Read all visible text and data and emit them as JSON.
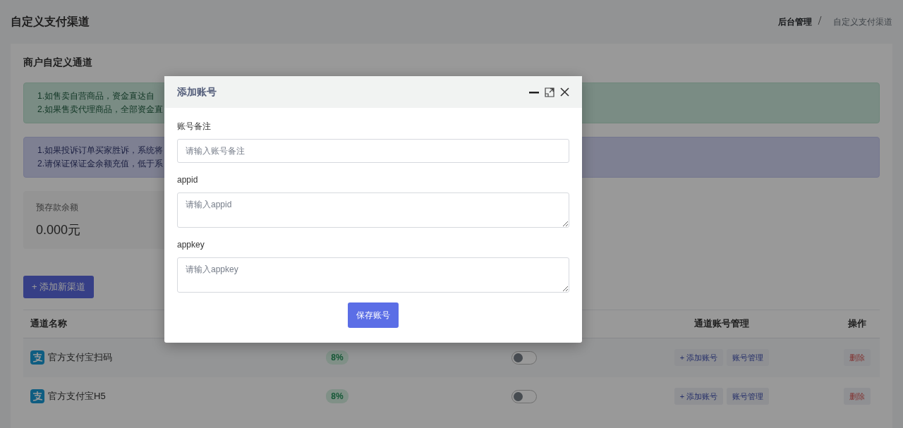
{
  "page_title": "自定义支付渠道",
  "breadcrumb": [
    {
      "label": "后台管理",
      "active": false
    },
    {
      "label": "自定义支付渠道",
      "active": true
    }
  ],
  "card_title": "商户自定义通道",
  "alerts": [
    {
      "kind": "success",
      "lines": [
        "1.如售卖自营商品，资金直达自",
        "2.如果售卖代理商品，全部资金直"
      ]
    },
    {
      "kind": "info",
      "lines": [
        "1.如果投诉订单买家胜诉，系统将",
        "2.请保证保证金余额充值，低于系"
      ]
    }
  ],
  "balance": {
    "label": "预存款余额",
    "value": "0.000元"
  },
  "add_button": "+ 添加新渠道",
  "table": {
    "columns": {
      "column_1": "通道名称",
      "column_4": "通道账号管理",
      "column_5": "操作"
    },
    "rows": [
      {
        "name": "官方支付宝扫码",
        "rate": "8%",
        "enabled": false,
        "add_account": "+ 添加账号",
        "manage": "账号管理",
        "delete": "删除"
      },
      {
        "name": "官方支付宝H5",
        "rate": "8%",
        "enabled": false,
        "add_account": "+ 添加账号",
        "manage": "账号管理",
        "delete": "删除"
      }
    ]
  },
  "modal": {
    "title": "添加账号",
    "fields": [
      {
        "kind": "input",
        "label": "账号备注",
        "placeholder": "请输入账号备注"
      },
      {
        "kind": "textarea",
        "label": "appid",
        "placeholder": "请输入appid"
      },
      {
        "kind": "textarea",
        "label": "appkey",
        "placeholder": "请输入appkey"
      }
    ],
    "submit": "保存账号"
  }
}
